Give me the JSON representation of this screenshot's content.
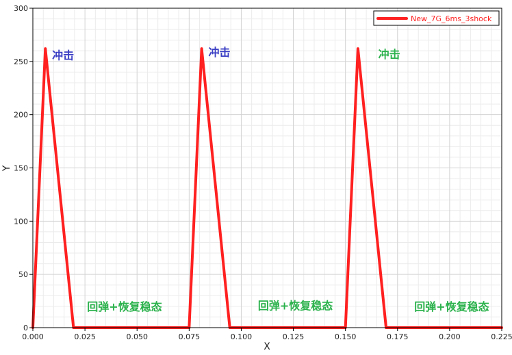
{
  "chart_data": {
    "type": "line",
    "xlabel": "X",
    "ylabel": "Y",
    "xlim": [
      0,
      0.225
    ],
    "ylim": [
      0,
      300
    ],
    "x_ticks": [
      "0.000",
      "0.025",
      "0.050",
      "0.075",
      "0.100",
      "0.125",
      "0.150",
      "0.175",
      "0.200",
      "0.225"
    ],
    "y_ticks": [
      "0",
      "50",
      "100",
      "150",
      "200",
      "250",
      "300"
    ],
    "grid": true,
    "legend_position": "top-right",
    "series": [
      {
        "name": "New_7G_6ms_3shock",
        "color": "#ff2020",
        "x": [
          0.0,
          0.006,
          0.0195,
          0.075,
          0.081,
          0.0945,
          0.15,
          0.156,
          0.1695,
          0.225
        ],
        "y": [
          0,
          262,
          0,
          0,
          262,
          0,
          0,
          262,
          0,
          0
        ]
      }
    ],
    "annotations": [
      {
        "text": "冲击",
        "x": 0.0145,
        "y": 252,
        "color": "#3b3fc4"
      },
      {
        "text": "冲击",
        "x": 0.0895,
        "y": 255,
        "color": "#3b3fc4"
      },
      {
        "text": "冲击",
        "x": 0.171,
        "y": 253,
        "color": "#2bb24c"
      },
      {
        "text": "回弹+恢复稳态",
        "x": 0.044,
        "y": 16,
        "color": "#2bb24c"
      },
      {
        "text": "回弹+恢复稳态",
        "x": 0.126,
        "y": 17,
        "color": "#2bb24c"
      },
      {
        "text": "回弹+恢复稳态",
        "x": 0.201,
        "y": 16,
        "color": "#2bb24c"
      }
    ]
  }
}
